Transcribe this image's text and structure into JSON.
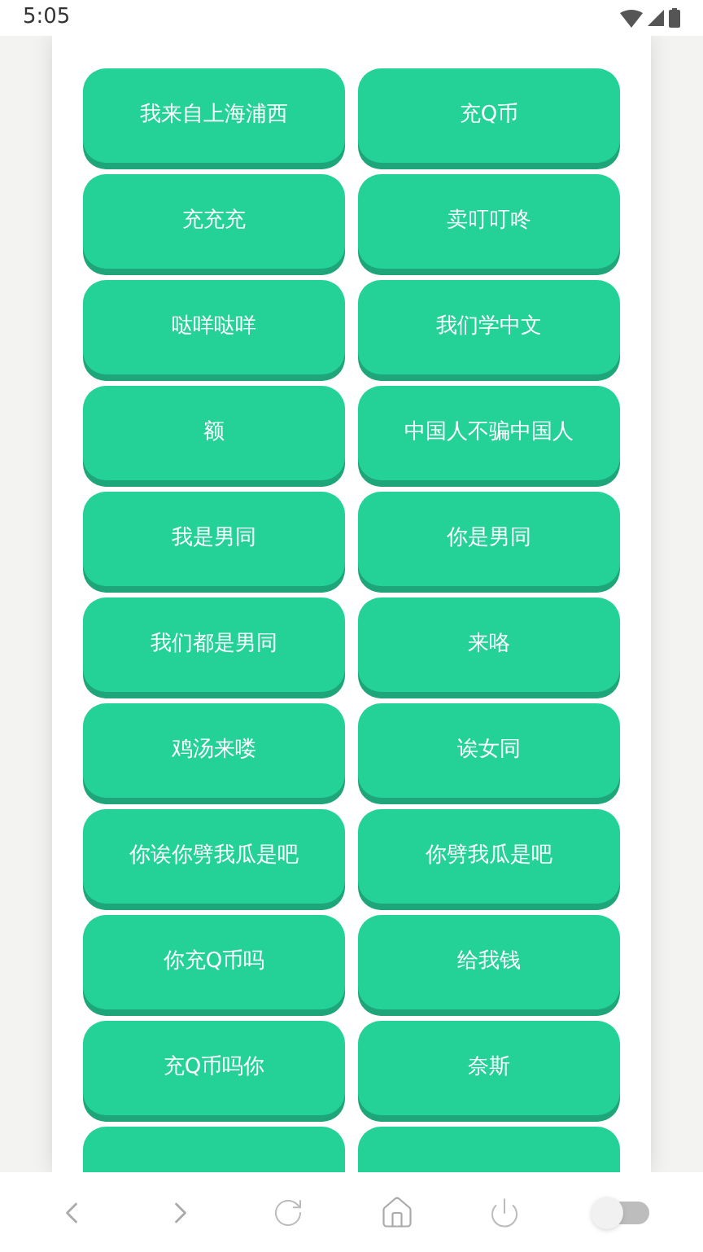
{
  "status_bar": {
    "time": "5:05"
  },
  "buttons": [
    {
      "label": "我来自上海浦西"
    },
    {
      "label": "充Q币"
    },
    {
      "label": "充充充"
    },
    {
      "label": "卖叮叮咚"
    },
    {
      "label": "哒咩哒咩"
    },
    {
      "label": "我们学中文"
    },
    {
      "label": "额"
    },
    {
      "label": "中国人不骗中国人"
    },
    {
      "label": "我是男同"
    },
    {
      "label": "你是男同"
    },
    {
      "label": "我们都是男同"
    },
    {
      "label": "来咯"
    },
    {
      "label": "鸡汤来喽"
    },
    {
      "label": "诶女同"
    },
    {
      "label": "你诶你劈我瓜是吧"
    },
    {
      "label": "你劈我瓜是吧"
    },
    {
      "label": "你充Q币吗"
    },
    {
      "label": "给我钱"
    },
    {
      "label": "充Q币吗你"
    },
    {
      "label": "奈斯"
    }
  ],
  "cut_off_buttons": [
    {
      "kind": "blank"
    },
    {
      "kind": "blank"
    }
  ],
  "browser_bar": {
    "toggle_on": false
  }
}
